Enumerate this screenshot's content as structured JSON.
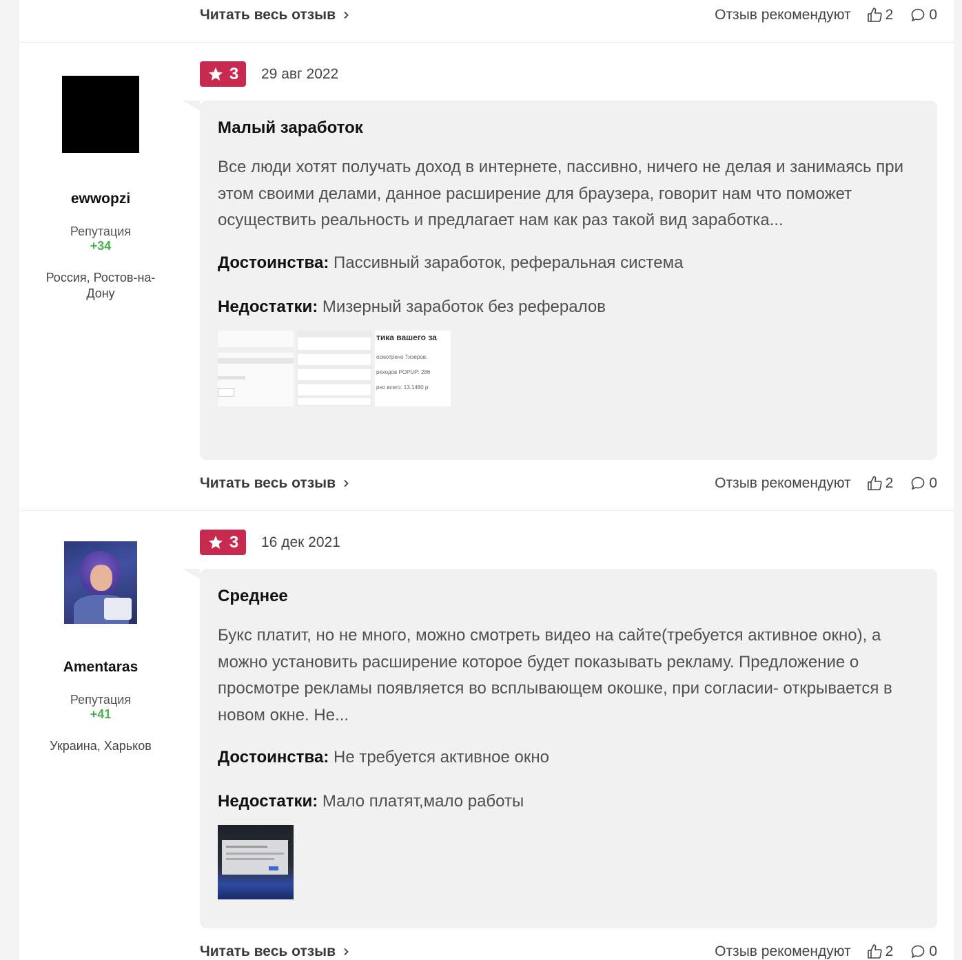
{
  "common": {
    "read_full": "Читать весь отзыв",
    "recommend_label": "Отзыв рекомендуют",
    "likes": "2",
    "comments": "0",
    "reputation_label": "Репутация",
    "pros_label": "Достоинства:",
    "cons_label": "Недостатки:"
  },
  "colors": {
    "badge": "#c8294f",
    "reputation": "#4caf50",
    "bubble_bg": "#f1f1f2"
  },
  "reviews": [
    {
      "author": {
        "name": "ewwopzi",
        "reputation": "+34",
        "location": "Россия, Ростов-на-Дону"
      },
      "rating": "3",
      "date": "29 авг 2022",
      "title": "Малый заработок",
      "text": "Все люди хотят получать доход в интернете, пассивно, ничего не делая и занимаясь при этом своими делами, данное расширение для браузера, говорит нам что поможет осуществить реальность и предлагает нам как раз такой вид заработка...",
      "pros": "Пассивный заработок, реферальная система",
      "cons": "Мизерный заработок без рефералов",
      "thumb_text": {
        "line1": "тика вашего за",
        "line2": "осмотрено Тизеров:",
        "line3": "реходов POPUP: 286",
        "line4": "рно всего: 13.1480 р"
      }
    },
    {
      "author": {
        "name": "Amentaras",
        "reputation": "+41",
        "location": "Украина, Харьков"
      },
      "rating": "3",
      "date": "16 дек 2021",
      "title": "Среднее",
      "text": "Букс платит, но не много, можно смотреть видео на сайте(требуется активное окно), а можно установить расширение которое будет показывать рекламу. Предложение о просмотре рекламы появляется во всплывающем окошке, при согласии- открывается в новом окне. Не...",
      "pros": "Не требуется активное окно",
      "cons": "Мало платят,мало работы"
    }
  ]
}
